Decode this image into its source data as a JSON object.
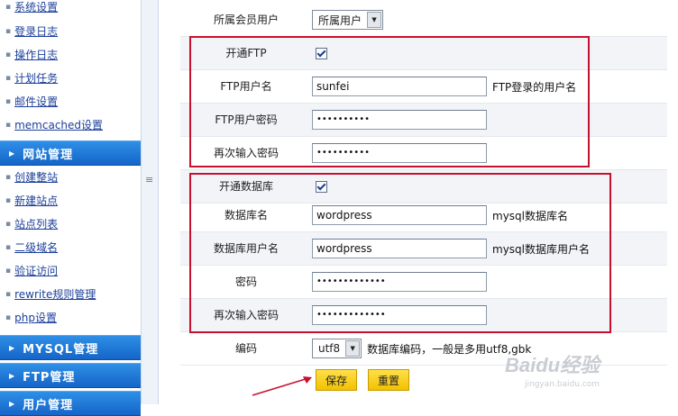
{
  "sidebar": {
    "links": [
      "系统设置",
      "登录日志",
      "操作日志",
      "计划任务",
      "邮件设置",
      "memcached设置"
    ],
    "site_section": "网站管理",
    "site_links": [
      "创建整站",
      "新建站点",
      "站点列表",
      "二级域名",
      "验证访问",
      "rewrite规则管理",
      "php设置"
    ],
    "mysql_section": "MYSQL管理",
    "ftp_section": "FTP管理",
    "user_section": "用户管理"
  },
  "splitter_glyph": "≡",
  "form": {
    "member": {
      "label": "所属会员用户",
      "value": "所属用户"
    },
    "ftp_enable": {
      "label": "开通FTP",
      "checked": true
    },
    "ftp_user": {
      "label": "FTP用户名",
      "value": "sunfei",
      "hint": "FTP登录的用户名"
    },
    "ftp_pass": {
      "label": "FTP用户密码",
      "value": "••••••••••"
    },
    "ftp_pass2": {
      "label": "再次输入密码",
      "value": "••••••••••"
    },
    "db_enable": {
      "label": "开通数据库",
      "checked": true
    },
    "db_name": {
      "label": "数据库名",
      "value": "wordpress",
      "hint": "mysql数据库名"
    },
    "db_user": {
      "label": "数据库用户名",
      "value": "wordpress",
      "hint": "mysql数据库用户名"
    },
    "db_pass": {
      "label": "密码",
      "value": "•••••••••••••"
    },
    "db_pass2": {
      "label": "再次输入密码",
      "value": "•••••••••••••"
    },
    "encoding": {
      "label": "编码",
      "value": "utf8",
      "hint": "数据库编码，一般是多用utf8,gbk"
    },
    "save_label": "保存",
    "reset_label": "重置"
  },
  "watermark": {
    "brand": "Baidu经验",
    "url": "jingyan.baidu.com"
  },
  "colors": {
    "highlight_box": "#c8102e",
    "sidebar_header": "#1565c8",
    "button": "#f2c100",
    "link": "#1c3f9a"
  }
}
